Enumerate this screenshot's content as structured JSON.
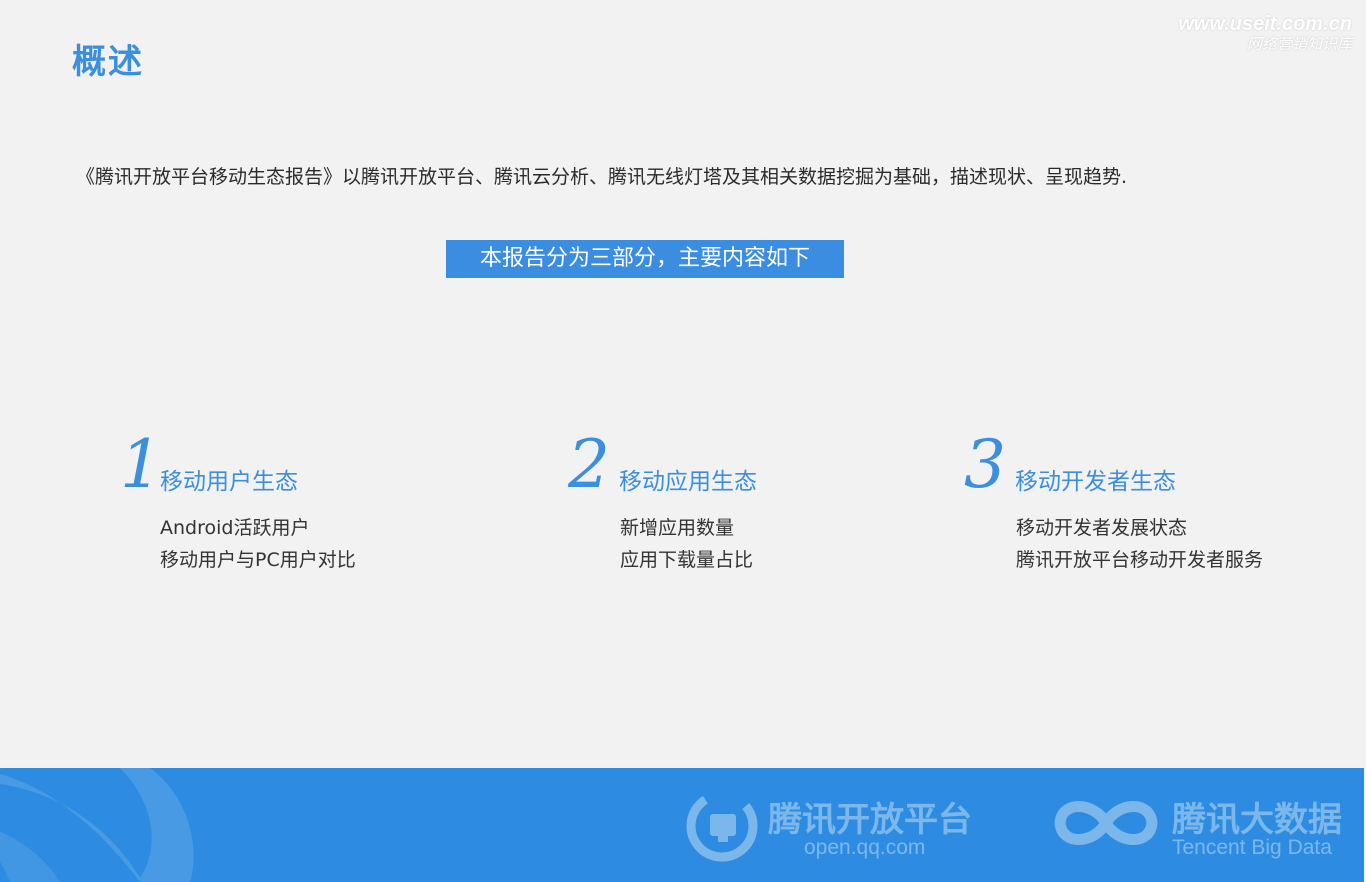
{
  "header": {
    "title": "概述",
    "watermark_url": "www.useit.com.cn",
    "watermark_sub": "网络营销知识库"
  },
  "intro": {
    "text": "《腾讯开放平台移动生态报告》以腾讯开放平台、腾讯云分析、腾讯无线灯塔及其相关数据挖掘为基础，描述现状、呈现趋势."
  },
  "banner": {
    "text": "本报告分为三部分，主要内容如下"
  },
  "sections": [
    {
      "number": "1",
      "title": "移动用户生态",
      "items": [
        "Android活跃用户",
        "移动用户与PC用户对比"
      ]
    },
    {
      "number": "2",
      "title": "移动应用生态",
      "items": [
        "新增应用数量",
        "应用下载量占比"
      ]
    },
    {
      "number": "3",
      "title": "移动开发者生态",
      "items": [
        "移动开发者发展状态",
        "腾讯开放平台移动开发者服务"
      ]
    }
  ],
  "footer": {
    "logo_open_cn": "腾讯开放平台",
    "logo_open_en": "open.qq.com",
    "logo_bigdata_cn": "腾讯大数据",
    "logo_bigdata_en": "Tencent Big Data",
    "colors": {
      "background": "#2d8ce1",
      "accent": "#3b8fdd"
    }
  }
}
